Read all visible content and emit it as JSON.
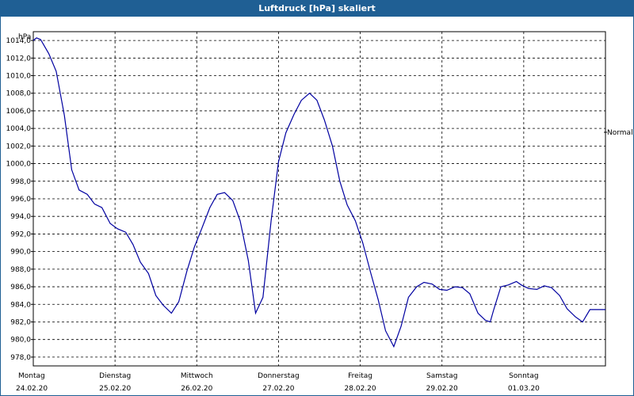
{
  "window": {
    "title": "Luftdruck [hPa] skaliert"
  },
  "chart_data": {
    "type": "line",
    "title": "Luftdruck [hPa] skaliert",
    "ylabel": "hPa",
    "right_label": "Normal",
    "ylim": [
      977,
      1015
    ],
    "yticks": [
      "978,0",
      "980,0",
      "982,0",
      "984,0",
      "986,0",
      "988,0",
      "990,0",
      "992,0",
      "994,0",
      "996,0",
      "998,0",
      "1000,0",
      "1002,0",
      "1004,0",
      "1006,0",
      "1008,0",
      "1010,0",
      "1012,0",
      "1014,0"
    ],
    "ytick_values": [
      978,
      980,
      982,
      984,
      986,
      988,
      990,
      992,
      994,
      996,
      998,
      1000,
      1002,
      1004,
      1006,
      1008,
      1010,
      1012,
      1014
    ],
    "xlim": [
      0,
      7
    ],
    "grid": true,
    "legend": "none",
    "line_color": "#0000a0",
    "days": [
      {
        "name": "Montag",
        "date": "24.02.20"
      },
      {
        "name": "Dienstag",
        "date": "25.02.20"
      },
      {
        "name": "Mittwoch",
        "date": "26.02.20"
      },
      {
        "name": "Donnerstag",
        "date": "27.02.20"
      },
      {
        "name": "Freitag",
        "date": "28.02.20"
      },
      {
        "name": "Samstag",
        "date": "29.02.20"
      },
      {
        "name": "Sonntag",
        "date": "01.03.20"
      }
    ],
    "series": [
      {
        "x": [
          0,
          0.04,
          0.09,
          0.19,
          0.28,
          0.38,
          0.47,
          0.56,
          0.66,
          0.75,
          0.84,
          0.94,
          1.03,
          1.13,
          1.22,
          1.31,
          1.41,
          1.5,
          1.59,
          1.69,
          1.78,
          1.88,
          1.97,
          2.06,
          2.16,
          2.25,
          2.34,
          2.44,
          2.53,
          2.63,
          2.72,
          2.81,
          2.91,
          3.0,
          3.09,
          3.19,
          3.28,
          3.38,
          3.47,
          3.56,
          3.66,
          3.75,
          3.84,
          3.94,
          4.03,
          4.13,
          4.22,
          4.31,
          4.41,
          4.5,
          4.59,
          4.69,
          4.78,
          4.88,
          4.97,
          5.06,
          5.16,
          5.25,
          5.34,
          5.44,
          5.53,
          5.59,
          5.63,
          5.72,
          5.81,
          5.91,
          5.97,
          6.06,
          6.16,
          6.25,
          6.34,
          6.44,
          6.53,
          6.63,
          6.72,
          6.81,
          6.91,
          7.0
        ],
        "y": [
          1014.0,
          1014.3,
          1014.1,
          1012.5,
          1010.5,
          1005.5,
          999.3,
          997.0,
          996.5,
          995.4,
          995.0,
          993.2,
          992.6,
          992.2,
          990.8,
          988.8,
          987.5,
          985.0,
          983.9,
          983.0,
          984.3,
          987.8,
          990.5,
          992.6,
          995.0,
          996.5,
          996.7,
          995.8,
          993.5,
          989.0,
          983.0,
          984.8,
          993.5,
          1000.2,
          1003.5,
          1005.6,
          1007.2,
          1008.0,
          1007.2,
          1005.0,
          1002.0,
          998.0,
          995.3,
          993.5,
          991.0,
          987.5,
          984.5,
          981.0,
          979.2,
          981.5,
          984.8,
          986.0,
          986.5,
          986.3,
          985.7,
          985.6,
          986.0,
          985.9,
          985.2,
          983.0,
          982.2,
          982.0,
          983.3,
          986.0,
          986.2,
          986.6,
          986.2,
          985.8,
          985.7,
          986.1,
          985.9,
          985.0,
          983.5,
          982.6,
          982.0,
          983.4,
          983.4,
          983.4
        ]
      }
    ]
  }
}
